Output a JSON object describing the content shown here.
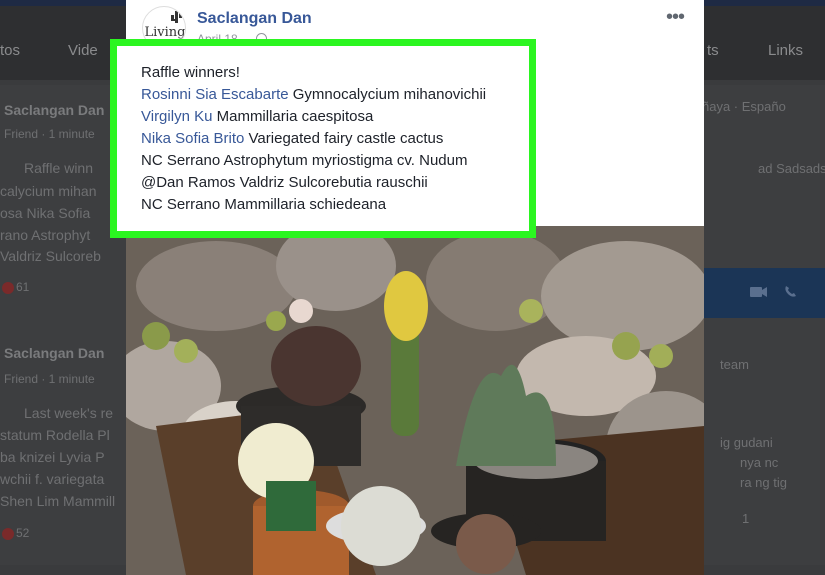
{
  "background": {
    "nav_items": [
      "tos",
      "Vide",
      "ts",
      "Links"
    ],
    "left_posts": [
      {
        "author": "Saclangan Dan",
        "meta": "Friend · 1 minute",
        "lines": [
          "Raffle winn",
          "calycium mihan",
          "osa Nika Sofia",
          "rano Astrophyt",
          "Valdriz Sulcoreb"
        ],
        "reactions": "61"
      },
      {
        "author": "Saclangan Dan",
        "meta": "Friend · 1 minute",
        "lines": [
          "Last week's re",
          "statum Rodella Pl",
          "ba knizei Lyvia P",
          "wchii f. variegata",
          "Shen Lim Mammill"
        ],
        "reactions": "52"
      }
    ],
    "right_lines": [
      "ñaya · Españo",
      "ad Sadsadsa",
      "team",
      "ig gudani",
      "nya nc",
      "ra ng tig"
    ],
    "right_reactions": "1"
  },
  "post": {
    "author": "Saclangan Dan",
    "avatar_text": "Living",
    "date": "April 18",
    "more_label": "•••",
    "lines": [
      {
        "parts": [
          {
            "text": "Raffle winners!",
            "link": false
          }
        ]
      },
      {
        "parts": [
          {
            "text": "Rosinni Sia Escabarte",
            "link": true
          },
          {
            "text": " Gymnocalycium mihanovichii",
            "link": false
          }
        ]
      },
      {
        "parts": [
          {
            "text": "Virgilyn Ku",
            "link": true
          },
          {
            "text": " Mammillaria caespitosa",
            "link": false
          }
        ]
      },
      {
        "parts": [
          {
            "text": "Nika Sofia Brito",
            "link": true
          },
          {
            "text": " Variegated fairy castle cactus",
            "link": false
          }
        ]
      },
      {
        "parts": [
          {
            "text": "NC Serrano Astrophytum myriostigma cv. Nudum",
            "link": false
          }
        ]
      },
      {
        "parts": [
          {
            "text": "@Dan Ramos Valdriz Sulcorebutia rauschii",
            "link": false
          }
        ]
      },
      {
        "parts": [
          {
            "text": "NC Serrano Mammillaria schiedeana",
            "link": false
          }
        ]
      }
    ]
  },
  "colors": {
    "highlight": "#2bf520",
    "link": "#385898",
    "text": "#1d2129"
  }
}
